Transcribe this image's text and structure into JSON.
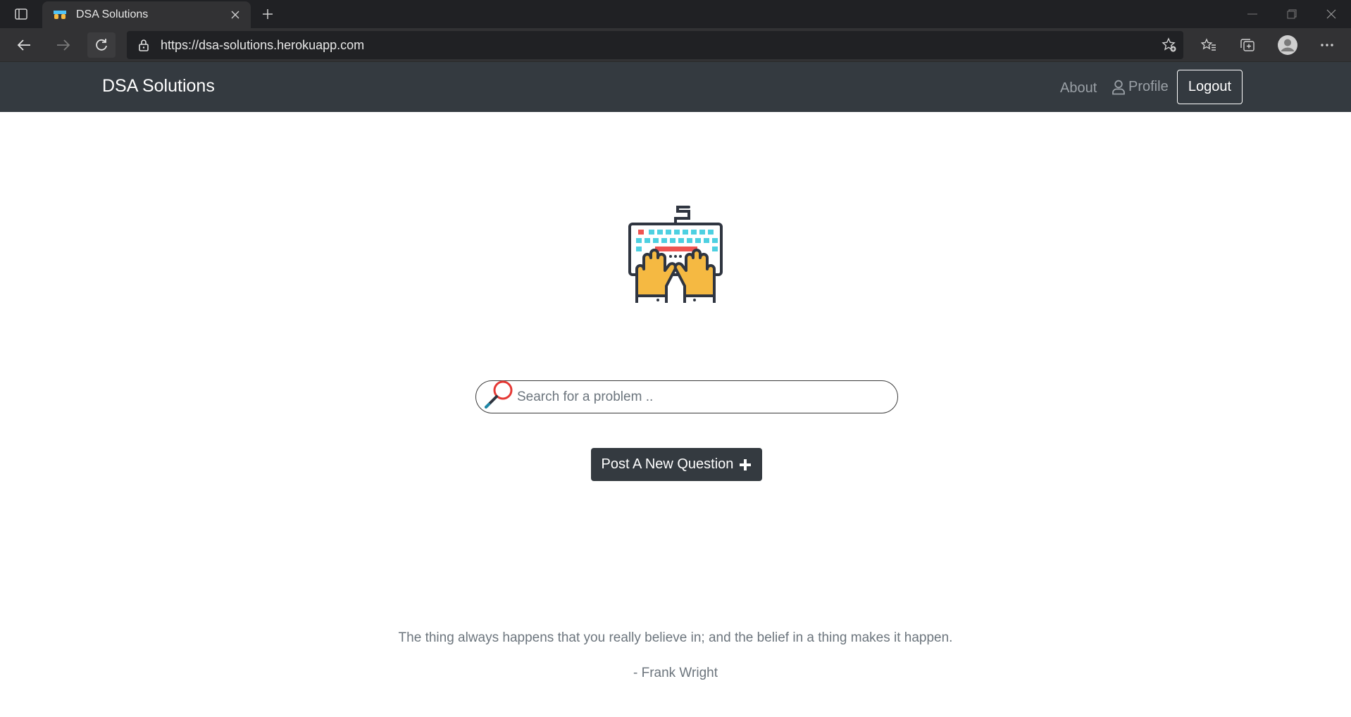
{
  "browser": {
    "tab_title": "DSA Solutions",
    "url": "https://dsa-solutions.herokuapp.com"
  },
  "navbar": {
    "brand": "DSA Solutions",
    "about_label": "About",
    "profile_label": "Profile",
    "logout_label": "Logout"
  },
  "main": {
    "search_placeholder": "Search for a problem ..",
    "post_button_label": "Post A New Question"
  },
  "footer_quote": {
    "text": "The thing always happens that you really believe in; and the belief in a thing makes it happen.",
    "author": "- Frank Wright"
  },
  "colors": {
    "navbar_bg": "#343a40",
    "chrome_bg": "#202124",
    "accent_button": "#343a40"
  },
  "icons": [
    "sidebar-toggle-icon",
    "favicon-icon",
    "close-icon",
    "plus-icon",
    "back-icon",
    "forward-icon",
    "reload-icon",
    "lock-icon",
    "star-add-icon",
    "favorites-icon",
    "collections-icon",
    "profile-avatar-icon",
    "more-icon",
    "user-icon",
    "keyboard-hands-icon",
    "search-icon",
    "plus-circle-icon"
  ]
}
